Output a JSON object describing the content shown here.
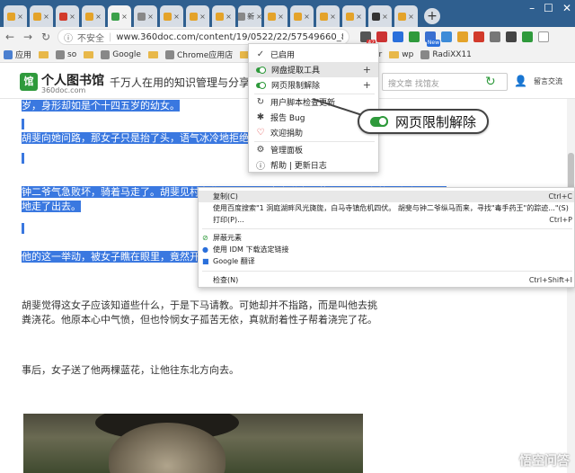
{
  "tabs": [
    {
      "label": "",
      "active": false,
      "color": "#e4a32a"
    },
    {
      "label": "",
      "active": false,
      "color": "#e4a32a"
    },
    {
      "label": "",
      "active": false,
      "color": "#d23a2b"
    },
    {
      "label": "",
      "active": false,
      "color": "#e4a32a"
    },
    {
      "label": "",
      "active": true,
      "color": "#3aa04a"
    },
    {
      "label": "",
      "active": false,
      "color": "#888888"
    },
    {
      "label": "",
      "active": false,
      "color": "#e4a32a"
    },
    {
      "label": "",
      "active": false,
      "color": "#e4a32a"
    },
    {
      "label": "",
      "active": false,
      "color": "#e4a32a"
    },
    {
      "label": "新",
      "active": false,
      "color": "#888888"
    },
    {
      "label": "",
      "active": false,
      "color": "#e4a32a"
    },
    {
      "label": "",
      "active": false,
      "color": "#e4a32a"
    },
    {
      "label": "",
      "active": false,
      "color": "#e4a32a"
    },
    {
      "label": "",
      "active": false,
      "color": "#e4a32a"
    },
    {
      "label": "",
      "active": false,
      "color": "#333333"
    },
    {
      "label": "",
      "active": false,
      "color": "#e4a32a"
    }
  ],
  "address": {
    "security": "不安全",
    "url": "www.360doc.com/content/19/0522/22/57549660_8375688..."
  },
  "extensions": {
    "badge1": "42",
    "badge2": "New"
  },
  "bookmarks": [
    {
      "label": "应用",
      "type": "apps"
    },
    {
      "label": "",
      "type": "folder"
    },
    {
      "label": "so",
      "type": "site"
    },
    {
      "label": "",
      "type": "folder"
    },
    {
      "label": "Google",
      "type": "site"
    },
    {
      "label": "",
      "type": "folder"
    },
    {
      "label": "Chrome应用店",
      "type": "site"
    },
    {
      "label": "",
      "type": "folder"
    },
    {
      "label": "IP",
      "type": "site"
    },
    {
      "label": "dream",
      "type": "folder"
    },
    {
      "label": "Converter",
      "type": "folder"
    },
    {
      "label": "wp",
      "type": "folder"
    },
    {
      "label": "RadiXX11",
      "type": "site"
    }
  ],
  "site": {
    "logo_glyph": "馆",
    "name": "个人图书馆",
    "domain": "360doc.com",
    "slogan": "千万人在用的知识管理与分享平台",
    "search_placeholder": "搜文章 找馆友",
    "message_link": "留言交流"
  },
  "content": {
    "line1": "岁，身形却如是个十四五岁的幼女。",
    "line2": "胡斐向她问路，那女子只是抬了头，语气冰冷地拒绝。",
    "line3": "钟二爷气急败坏，骑着马走了。胡斐见村女贫困，而又用鼻尖说出了花瓶，正是有着马上小心眼那",
    "line4": "地走了出去。",
    "line5": "他的这一举动，被女子瞧在眼里，竟然开口问他",
    "para1": "胡斐觉得这女子应该知道些什么，于是下马请教。可她却并不指路，而是叫他去挑粪浇花。他原本心中气愤，但也怜悯女子孤苦无依，真就耐着性子帮着浇完了花。",
    "para2": "事后，女子送了他两棵蓝花，让他往东北方向去。"
  },
  "ext_menu": {
    "items": [
      {
        "label": "已启用",
        "kind": "check",
        "plus": false
      },
      {
        "label": "网盘提取工具",
        "kind": "toggle",
        "plus": true
      },
      {
        "label": "网页限制解除",
        "kind": "toggle",
        "plus": true
      },
      {
        "label": "用户脚本检查更新",
        "kind": "refresh",
        "plus": false
      },
      {
        "label": "报告 Bug",
        "kind": "bug",
        "plus": false
      },
      {
        "label": "欢迎捐助",
        "kind": "heart",
        "plus": false
      },
      {
        "label": "管理面板",
        "kind": "gear",
        "plus": false
      },
      {
        "label": "帮助 | 更新日志",
        "kind": "info",
        "plus": false
      }
    ]
  },
  "callout": {
    "label": "网页限制解除"
  },
  "context_menu": {
    "copy": "复制(C)",
    "copy_shortcut": "Ctrl+C",
    "search": "使用百度搜索\"1    洞庭湖畔风光旖旎，白马寺镇危机四伏。    胡斐与钟二爷纵马而来，寻找\"毒手药王\"的踪迹...\"(S)",
    "print": "打印(P)...",
    "print_shortcut": "Ctrl+P",
    "block": "屏蔽元素",
    "idm": "使用 IDM 下载选定链接",
    "translate": "Google 翻译",
    "inspect": "检查(N)",
    "inspect_shortcut": "Ctrl+Shift+I"
  },
  "watermark": "悟空问答"
}
